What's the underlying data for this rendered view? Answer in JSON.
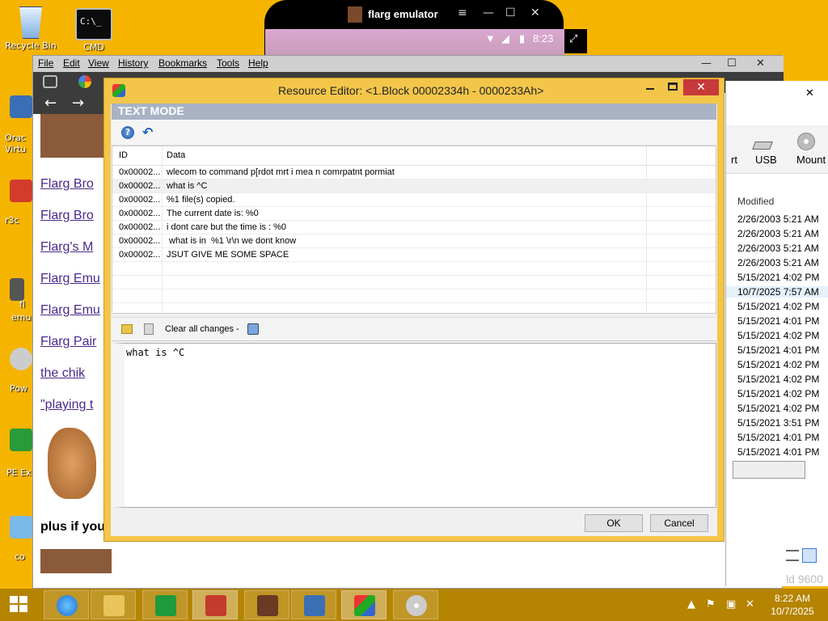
{
  "desktop": {
    "icons": [
      {
        "label": "Recycle Bin"
      },
      {
        "label": "CMD",
        "glyph": "C:\\_"
      }
    ],
    "side_labels": [
      "Orac",
      "Virtu",
      "r3c",
      "fl",
      "emu",
      "Pow",
      "PE Ex",
      "co"
    ]
  },
  "emulator": {
    "title": "flarg emulator",
    "time": "8:23",
    "controls": {
      "menu": "≡",
      "minimize": "—",
      "maximize": "☐",
      "close": "✕"
    }
  },
  "browser": {
    "menu": [
      "File",
      "Edit",
      "View",
      "History",
      "Bookmarks",
      "Tools",
      "Help"
    ],
    "window_controls": {
      "minimize": "—",
      "maximize": "☐",
      "close": "✕"
    },
    "nav": {
      "back": "←",
      "forward": "→"
    },
    "links": [
      "Flarg Bro",
      "Flarg Bro",
      "Flarg's M",
      "Flarg Emu",
      "Flarg Emu",
      "Flarg Pair",
      "the chik",
      "\"playing t"
    ],
    "plain_text": "plus if you"
  },
  "explorer": {
    "ribbon": {
      "usb": "USB",
      "mount": "Mount",
      "partial": "rt"
    },
    "column_header": "Modified",
    "dates": [
      "2/26/2003 5:21 AM",
      "2/26/2003 5:21 AM",
      "2/26/2003 5:21 AM",
      "2/26/2003 5:21 AM",
      "5/15/2021 4:02 PM",
      "10/7/2025 7:57 AM",
      "5/15/2021 4:02 PM",
      "5/15/2021 4:01 PM",
      "5/15/2021 4:02 PM",
      "5/15/2021 4:01 PM",
      "5/15/2021 4:02 PM",
      "5/15/2021 4:02 PM",
      "5/15/2021 4:02 PM",
      "5/15/2021 4:02 PM",
      "5/15/2021 3:51 PM",
      "5/15/2021 4:01 PM",
      "5/15/2021 4:01 PM"
    ],
    "selected_index": 5,
    "status": "ld 9600"
  },
  "dialog": {
    "title": "Resource Editor: <1.Block 00002334h - 0000233Ah>",
    "mode_label": "TEXT MODE",
    "columns": {
      "id": "ID",
      "data": "Data"
    },
    "rows": [
      {
        "id": "0x00002...",
        "data": "wlecom to command p[rdot mrt i mea n comrpatnt pormiat"
      },
      {
        "id": "0x00002...",
        "data": "what is ^C"
      },
      {
        "id": "0x00002...",
        "data": "%1 file(s) copied."
      },
      {
        "id": "0x00002...",
        "data": "The current date is: %0"
      },
      {
        "id": "0x00002...",
        "data": "i dont care but the time is : %0"
      },
      {
        "id": "0x00002...",
        "data": " what is in  %1 \\r\\n we dont know"
      },
      {
        "id": "0x00002...",
        "data": "JSUT GIVE ME SOME SPACE"
      }
    ],
    "selected_row": 1,
    "clear_label": "Clear all changes -",
    "editor_text": "what is ^C",
    "ok_label": "OK",
    "cancel_label": "Cancel",
    "close_glyph": "✕",
    "help_glyph": "?",
    "undo_glyph": "↶"
  },
  "taskbar": {
    "clock_time": "8:22 AM",
    "clock_date": "10/7/2025",
    "colors": {
      "accent": "#f5b400",
      "taskbar": "#b58400",
      "dialog_frame": "#f3c64a",
      "close": "#c7393a"
    }
  }
}
